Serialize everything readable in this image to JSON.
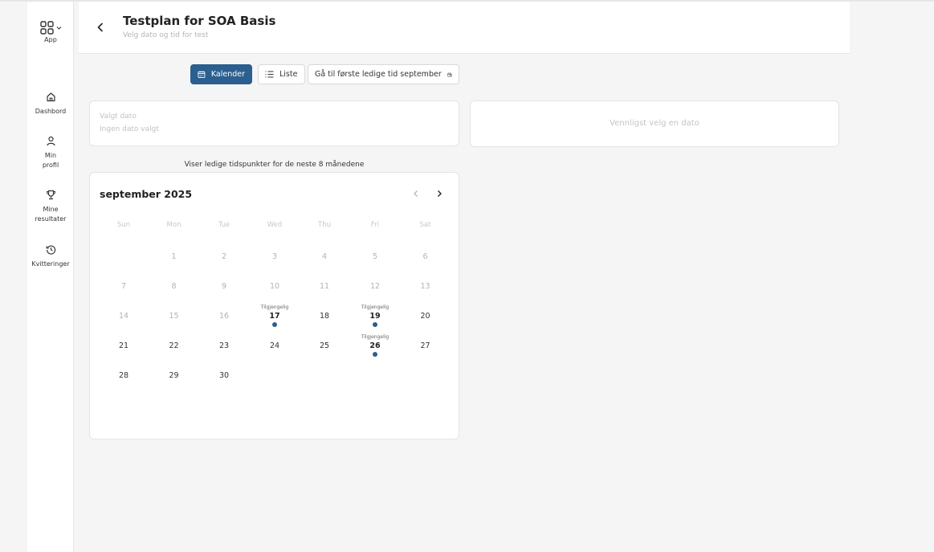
{
  "sidebar": {
    "app_label": "App",
    "items": [
      {
        "icon": "home-icon",
        "lines": [
          "Dashbord"
        ]
      },
      {
        "icon": "user-icon",
        "lines": [
          "Min",
          "profil"
        ]
      },
      {
        "icon": "trophy-icon",
        "lines": [
          "Mine",
          "resultater"
        ]
      },
      {
        "icon": "history-icon",
        "lines": [
          "Kvitteringer"
        ]
      }
    ]
  },
  "header": {
    "title": "Testplan for SOA Basis",
    "subtitle": "Velg dato og tid for test"
  },
  "toolbar": {
    "calendar_label": "Kalender",
    "list_label": "Liste",
    "goto_label": "Gå til første ledige tid september"
  },
  "selected_date": {
    "label": "Valgt dato",
    "value": "Ingen dato valgt"
  },
  "right_panel": {
    "message": "Vennligst velg en dato"
  },
  "availability_info": "Viser ledige tidspunkter for de neste 8 månedene",
  "calendar": {
    "month_title": "september 2025",
    "weekdays": [
      "Sun",
      "Mon",
      "Tue",
      "Wed",
      "Thu",
      "Fri",
      "Sat"
    ],
    "first_weekday_index": 1,
    "days_in_month": 30,
    "past_until": 16,
    "available_tag": "Tilgjengelig",
    "available_days": [
      17,
      19,
      26
    ]
  },
  "colors": {
    "accent": "#2b5f8f"
  }
}
